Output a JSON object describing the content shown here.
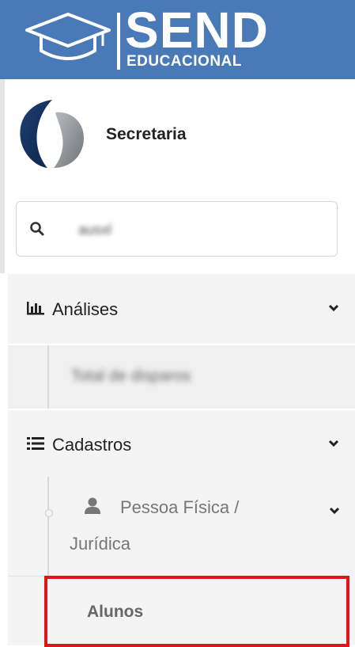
{
  "header": {
    "brand_main": "SEND",
    "brand_sub": "EDUCACIONAL",
    "logo_icon": "graduation-cap-icon",
    "background_color": "#4a79b8"
  },
  "profile": {
    "name": "Secretaria"
  },
  "search": {
    "value": "ausxl"
  },
  "menu": {
    "analises": {
      "label": "Análises",
      "icon": "bar-chart-icon",
      "children": [
        {
          "label": "Total de disparos"
        }
      ]
    },
    "cadastros": {
      "label": "Cadastros",
      "icon": "list-icon",
      "children": [
        {
          "label_line1": "Pessoa Física /",
          "label_line2": "Jurídica",
          "icon": "user-icon",
          "children": [
            {
              "label": "Alunos"
            }
          ]
        }
      ]
    }
  },
  "colors": {
    "highlight_border": "#e0141b",
    "menu_bg": "#f4f4f4"
  }
}
